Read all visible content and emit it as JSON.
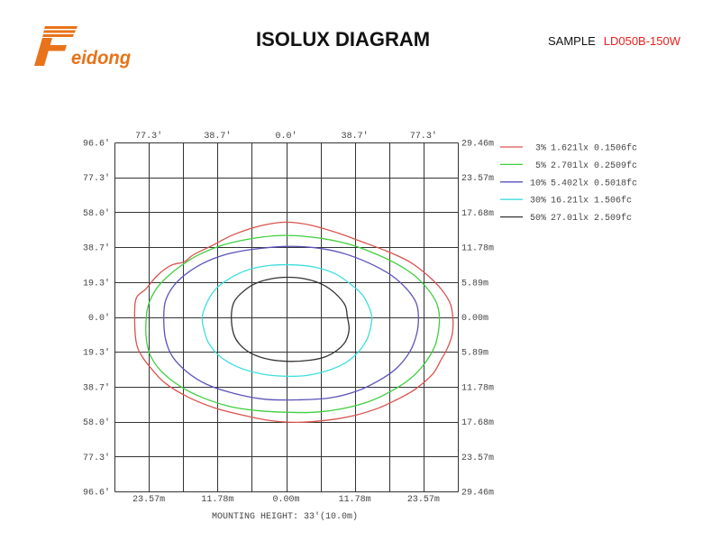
{
  "header": {
    "logo": {
      "letter": "F",
      "wordmark": "eidong"
    },
    "sample_label": "SAMPLE",
    "sample_model": "LD050B-150W"
  },
  "colors": {
    "brand_orange": "#e8731a",
    "model_red": "#e8201c",
    "grid": "#333333",
    "tick_text": "#444444"
  },
  "chart_data": {
    "type": "line",
    "title": "ISOLUX DIAGRAM",
    "annotation": "MOUNTING HEIGHT: 33'(10.0m)",
    "grid": true,
    "legend_position": "right",
    "xlim": [
      -29.46,
      29.46
    ],
    "ylim": [
      -29.46,
      29.46
    ],
    "grid_values": [
      -29.46,
      -23.57,
      -17.68,
      -11.78,
      -5.89,
      0,
      5.89,
      11.78,
      17.68,
      23.57,
      29.46
    ],
    "y_ticks": {
      "values": [
        29.46,
        23.57,
        17.68,
        11.78,
        5.89,
        0,
        -5.89,
        -11.78,
        -17.68,
        -23.57,
        -29.46
      ],
      "left_labels": [
        "96.6'",
        "77.3'",
        "58.0'",
        "38.7'",
        "19.3'",
        "0.0'",
        "19.3'",
        "38.7'",
        "58.0'",
        "77.3'",
        "96.6'"
      ],
      "right_labels": [
        "29.46m",
        "23.57m",
        "17.68m",
        "11.78m",
        "5.89m",
        "0.00m",
        "5.89m",
        "11.78m",
        "17.68m",
        "23.57m",
        "29.46m"
      ]
    },
    "x_ticks": {
      "values": [
        -23.57,
        -11.78,
        0,
        11.78,
        23.57
      ],
      "top_labels": [
        "77.3'",
        "38.7'",
        "0.0'",
        "38.7'",
        "77.3'"
      ],
      "bottom_labels": [
        "23.57m",
        "11.78m",
        "0.00m",
        "11.78m",
        "23.57m"
      ]
    },
    "series": [
      {
        "percent": "3%",
        "lux": "1.621lx",
        "fc": "0.1506fc",
        "color": "#d9534f",
        "points": [
          [
            -26.0,
            0
          ],
          [
            -25.7,
            3.2
          ],
          [
            -24.1,
            4.7
          ],
          [
            -22.1,
            7.0
          ],
          [
            -19.8,
            8.7
          ],
          [
            -17.5,
            9.3
          ],
          [
            -15.9,
            10.5
          ],
          [
            -12.8,
            12.0
          ],
          [
            -9.0,
            13.9
          ],
          [
            -4.3,
            15.4
          ],
          [
            0.0,
            16.0
          ],
          [
            4.2,
            15.5
          ],
          [
            8.8,
            14.2
          ],
          [
            12.7,
            12.8
          ],
          [
            17.3,
            11.1
          ],
          [
            21.2,
            9.3
          ],
          [
            24.3,
            7.0
          ],
          [
            26.6,
            4.7
          ],
          [
            28.1,
            2.4
          ],
          [
            28.6,
            0
          ],
          [
            28.5,
            -2.9
          ],
          [
            27.7,
            -5.2
          ],
          [
            26.6,
            -7.2
          ],
          [
            25.1,
            -9.7
          ],
          [
            22.0,
            -12.3
          ],
          [
            18.9,
            -14.0
          ],
          [
            15.8,
            -15.4
          ],
          [
            11.9,
            -16.6
          ],
          [
            7.3,
            -17.4
          ],
          [
            1.9,
            -17.8
          ],
          [
            -2.8,
            -17.5
          ],
          [
            -7.4,
            -16.6
          ],
          [
            -12.1,
            -15.4
          ],
          [
            -16.7,
            -13.6
          ],
          [
            -20.6,
            -11.3
          ],
          [
            -22.9,
            -9.0
          ],
          [
            -24.7,
            -6.7
          ],
          [
            -25.7,
            -4.4
          ]
        ]
      },
      {
        "percent": "5%",
        "lux": "2.701lx",
        "fc": "0.2509fc",
        "color": "#3fcf3f",
        "points": [
          [
            -24.0,
            0
          ],
          [
            -23.5,
            2.4
          ],
          [
            -22.1,
            5.0
          ],
          [
            -19.8,
            7.3
          ],
          [
            -17.5,
            9.0
          ],
          [
            -15.2,
            10.4
          ],
          [
            -11.3,
            12.0
          ],
          [
            -6.7,
            13.1
          ],
          [
            -2.0,
            13.7
          ],
          [
            1.9,
            13.7
          ],
          [
            6.5,
            13.2
          ],
          [
            11.1,
            12.2
          ],
          [
            15.0,
            10.8
          ],
          [
            18.9,
            9.0
          ],
          [
            22.0,
            7.0
          ],
          [
            24.3,
            4.7
          ],
          [
            25.8,
            2.4
          ],
          [
            26.3,
            0
          ],
          [
            26.1,
            -2.6
          ],
          [
            25.4,
            -5.2
          ],
          [
            23.5,
            -8.2
          ],
          [
            21.2,
            -10.5
          ],
          [
            18.1,
            -12.5
          ],
          [
            14.2,
            -14.3
          ],
          [
            9.6,
            -15.5
          ],
          [
            4.9,
            -16.1
          ],
          [
            0.0,
            -16.1
          ],
          [
            -5.1,
            -15.8
          ],
          [
            -9.7,
            -15.1
          ],
          [
            -14.4,
            -13.6
          ],
          [
            -18.2,
            -11.7
          ],
          [
            -21.3,
            -9.3
          ],
          [
            -23.2,
            -6.7
          ],
          [
            -24.0,
            -3.7
          ]
        ]
      },
      {
        "percent": "10%",
        "lux": "5.402lx",
        "fc": "0.5018fc",
        "color": "#5a52b8",
        "points": [
          [
            -21.0,
            0
          ],
          [
            -20.7,
            2.7
          ],
          [
            -19.5,
            5.0
          ],
          [
            -17.5,
            7.0
          ],
          [
            -14.4,
            9.0
          ],
          [
            -10.5,
            10.5
          ],
          [
            -5.9,
            11.4
          ],
          [
            0.0,
            11.9
          ],
          [
            4.9,
            11.7
          ],
          [
            9.6,
            10.8
          ],
          [
            14.2,
            9.1
          ],
          [
            18.1,
            7.0
          ],
          [
            20.7,
            4.7
          ],
          [
            22.3,
            2.4
          ],
          [
            22.7,
            0
          ],
          [
            22.4,
            -2.9
          ],
          [
            21.2,
            -5.9
          ],
          [
            18.9,
            -8.7
          ],
          [
            15.8,
            -10.8
          ],
          [
            11.9,
            -12.6
          ],
          [
            7.3,
            -13.7
          ],
          [
            1.9,
            -14.0
          ],
          [
            -3.6,
            -13.9
          ],
          [
            -9.0,
            -12.9
          ],
          [
            -13.6,
            -11.4
          ],
          [
            -17.0,
            -9.3
          ],
          [
            -19.5,
            -6.7
          ],
          [
            -20.7,
            -3.7
          ]
        ]
      },
      {
        "percent": "30%",
        "lux": "16.21lx",
        "fc": "1.506fc",
        "color": "#3fdede",
        "points": [
          [
            -14.4,
            0
          ],
          [
            -13.6,
            2.4
          ],
          [
            -12.1,
            4.7
          ],
          [
            -9.7,
            6.5
          ],
          [
            -6.7,
            7.9
          ],
          [
            -2.8,
            8.7
          ],
          [
            1.1,
            8.8
          ],
          [
            4.9,
            8.4
          ],
          [
            8.4,
            7.3
          ],
          [
            11.1,
            5.5
          ],
          [
            13.1,
            3.7
          ],
          [
            14.2,
            1.7
          ],
          [
            14.7,
            0
          ],
          [
            14.5,
            -1.7
          ],
          [
            13.9,
            -3.7
          ],
          [
            12.4,
            -5.9
          ],
          [
            10.1,
            -7.8
          ],
          [
            7.0,
            -9.1
          ],
          [
            3.4,
            -9.9
          ],
          [
            -0.5,
            -10.0
          ],
          [
            -4.3,
            -9.6
          ],
          [
            -8.2,
            -8.5
          ],
          [
            -11.3,
            -6.7
          ],
          [
            -13.3,
            -4.4
          ],
          [
            -14.1,
            -2.1
          ]
        ]
      },
      {
        "percent": "50%",
        "lux": "27.01lx",
        "fc": "2.509fc",
        "color": "#333333",
        "points": [
          [
            -9.4,
            0
          ],
          [
            -9.0,
            2.4
          ],
          [
            -7.7,
            4.0
          ],
          [
            -5.6,
            5.5
          ],
          [
            -2.8,
            6.4
          ],
          [
            0.3,
            6.7
          ],
          [
            3.4,
            6.4
          ],
          [
            6.2,
            5.5
          ],
          [
            8.4,
            4.0
          ],
          [
            10.1,
            2.0
          ],
          [
            10.5,
            0
          ],
          [
            10.8,
            -2.1
          ],
          [
            10.2,
            -4.1
          ],
          [
            8.8,
            -5.6
          ],
          [
            6.8,
            -6.7
          ],
          [
            4.2,
            -7.3
          ],
          [
            0.6,
            -7.5
          ],
          [
            -2.8,
            -7.2
          ],
          [
            -5.9,
            -6.2
          ],
          [
            -7.9,
            -4.7
          ],
          [
            -9.0,
            -2.9
          ]
        ]
      }
    ]
  }
}
